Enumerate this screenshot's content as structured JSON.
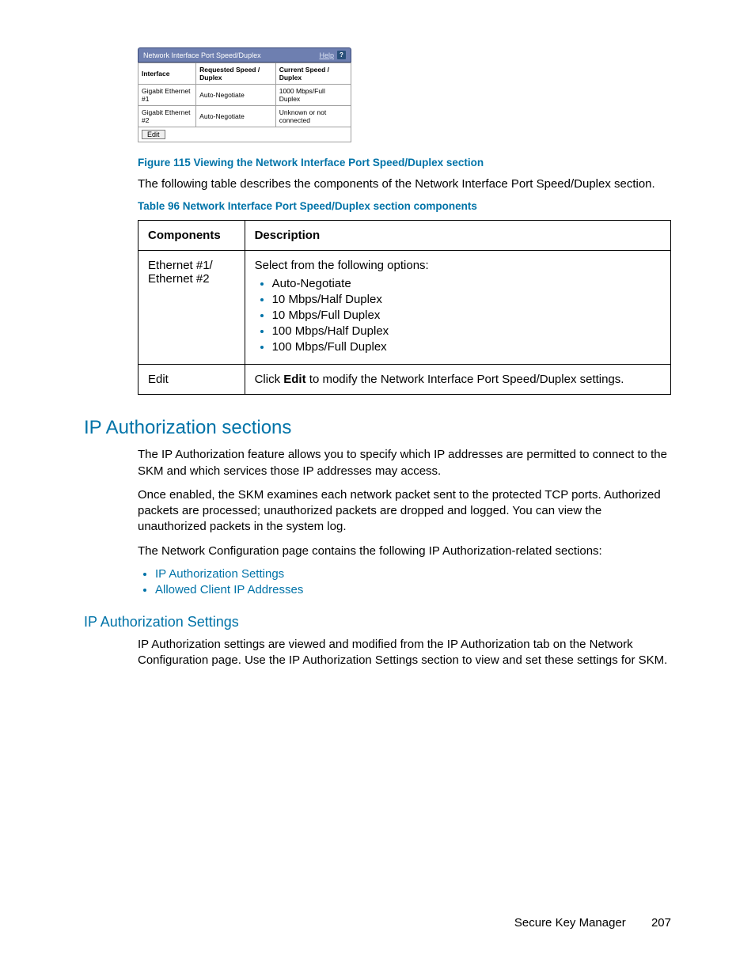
{
  "panel": {
    "title": "Network Interface Port Speed/Duplex",
    "help_label": "Help",
    "help_icon": "?",
    "headers": {
      "interface": "Interface",
      "requested": "Requested Speed / Duplex",
      "current": "Current Speed / Duplex"
    },
    "rows": [
      {
        "iface": "Gigabit Ethernet #1",
        "req": "Auto-Negotiate",
        "cur": "1000 Mbps/Full Duplex"
      },
      {
        "iface": "Gigabit Ethernet #2",
        "req": "Auto-Negotiate",
        "cur": "Unknown or not connected"
      }
    ],
    "edit_label": "Edit"
  },
  "fig_caption": "Figure 115 Viewing the Network Interface Port Speed/Duplex section",
  "para_intro": "The following table describes the components of the Network Interface Port Speed/Duplex section.",
  "tbl_caption": "Table 96 Network Interface Port Speed/Duplex section components",
  "content_table": {
    "headers": {
      "c1": "Components",
      "c2": "Description"
    },
    "row1": {
      "component": "Ethernet #1/ Ethernet #2",
      "desc_intro": "Select from the following options:",
      "options": [
        "Auto-Negotiate",
        "10 Mbps/Half Duplex",
        "10 Mbps/Full Duplex",
        "100 Mbps/Half Duplex",
        "100 Mbps/Full Duplex"
      ]
    },
    "row2": {
      "component": "Edit",
      "desc_pre": "Click ",
      "desc_bold": "Edit",
      "desc_post": " to modify the Network Interface Port Speed/Duplex settings."
    }
  },
  "section_heading": "IP Authorization sections",
  "section_para1": "The IP Authorization feature allows you to specify which IP addresses are permitted to connect to the SKM and which services those IP addresses may access.",
  "section_para2": "Once enabled, the SKM examines each network packet sent to the protected TCP ports. Authorized packets are processed; unauthorized packets are dropped and logged. You can view the unauthorized packets in the system log.",
  "section_para3": "The Network Configuration page contains the following IP Authorization-related sections:",
  "section_links": [
    "IP Authorization Settings",
    "Allowed Client IP Addresses"
  ],
  "subsection_heading": "IP Authorization Settings",
  "subsection_para": "IP Authorization settings are viewed and modified from the IP Authorization tab on the Network Configuration page. Use the IP Authorization Settings section to view and set these settings for SKM.",
  "footer": {
    "product": "Secure Key Manager",
    "page": "207"
  }
}
